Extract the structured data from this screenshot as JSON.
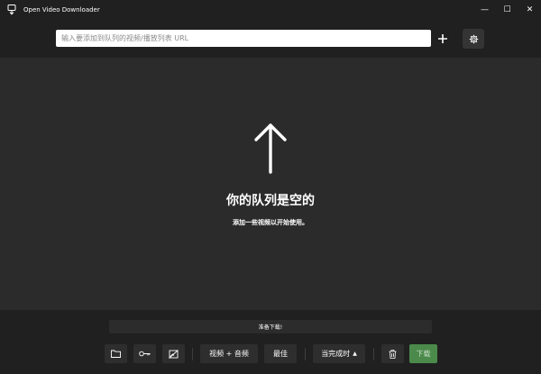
{
  "window": {
    "title": "Open Video Downloader",
    "minimize_glyph": "—",
    "maximize_glyph": "☐",
    "close_glyph": "✕"
  },
  "urlbar": {
    "placeholder": "输入要添加到队列的视频/播放列表 URL",
    "value": ""
  },
  "empty_state": {
    "title": "你的队列是空的",
    "subtitle": "添加一些视频以开始使用。"
  },
  "status": {
    "text": "准备下载!"
  },
  "toolbar": {
    "format_label": "视频 + 音频",
    "quality_label": "最佳",
    "after_completion_label": "当完成时",
    "download_label": "下载"
  },
  "colors": {
    "background": "#2b2b2b",
    "bars": "#202020",
    "button": "#2e2e2e",
    "download_accent": "#4b8a4b"
  },
  "icons": {
    "app": "app-logo-icon",
    "add": "plus-icon",
    "settings": "gear-icon",
    "empty": "arrow-up-icon",
    "folder": "folder-icon",
    "cookie": "key-icon",
    "subtitles": "no-image-icon",
    "delete": "trash-icon"
  }
}
